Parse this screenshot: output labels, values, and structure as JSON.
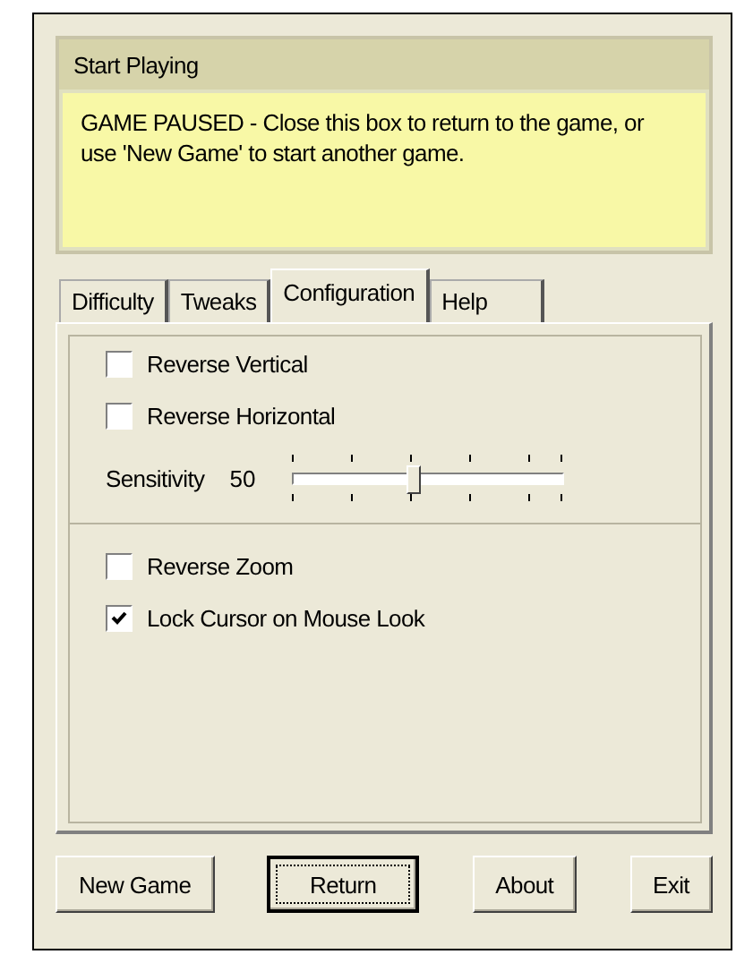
{
  "header": {
    "title": "Start Playing",
    "message": "GAME PAUSED - Close this box to return to the game, or use 'New Game' to start another game."
  },
  "tabs": [
    {
      "label": "Difficulty",
      "selected": false
    },
    {
      "label": "Tweaks",
      "selected": false
    },
    {
      "label": "Configuration",
      "selected": true
    },
    {
      "label": "Help",
      "selected": false
    }
  ],
  "groups": [
    {
      "items": [
        {
          "kind": "checkbox",
          "label": "Reverse Vertical",
          "checked": false
        },
        {
          "kind": "checkbox",
          "label": "Reverse Horizontal",
          "checked": false
        },
        {
          "kind": "slider",
          "label": "Sensitivity",
          "reading": "50",
          "level": 0.44
        }
      ]
    },
    {
      "items": [
        {
          "kind": "checkbox",
          "label": "Reverse Zoom",
          "checked": false
        },
        {
          "kind": "checkbox",
          "label": "Lock Cursor on Mouse Look",
          "checked": true
        }
      ]
    }
  ],
  "buttons": [
    {
      "label": "New Game",
      "focused": false
    },
    {
      "label": "Return",
      "focused": true
    },
    {
      "label": "About",
      "focused": false
    },
    {
      "label": "Exit",
      "focused": false
    }
  ]
}
